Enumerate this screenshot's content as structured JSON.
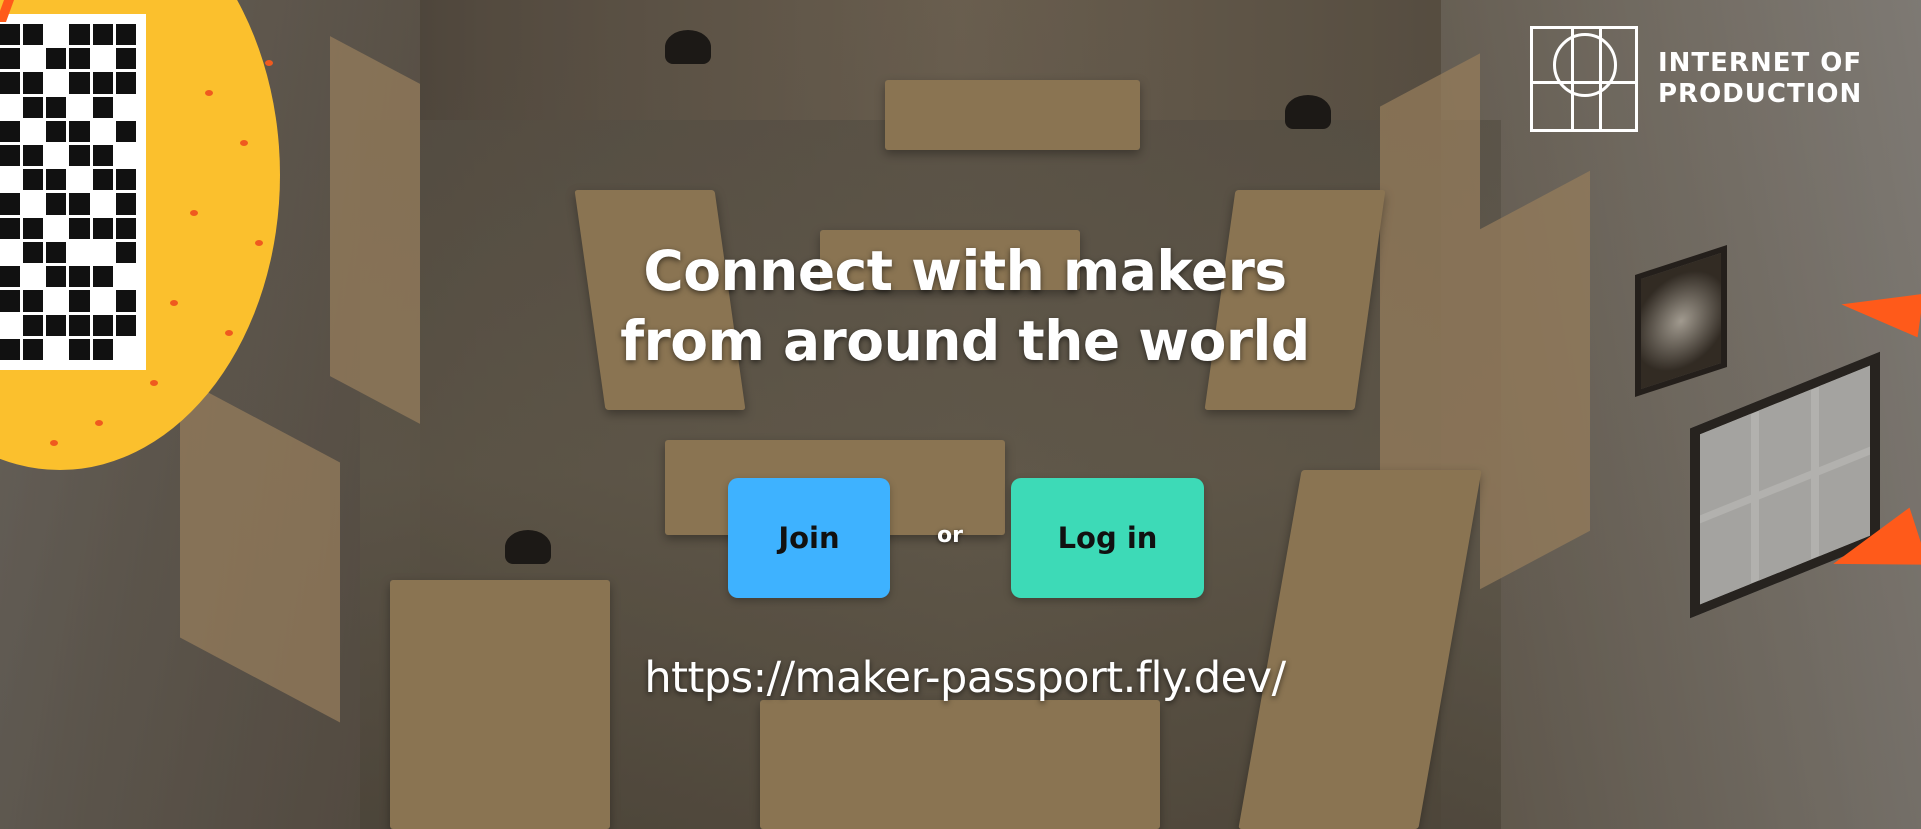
{
  "logo": {
    "line1": "INTERNET OF",
    "line2": "PRODUCTION"
  },
  "headline": {
    "line1": "Connect with makers",
    "line2": "from around the world"
  },
  "actions": {
    "join_label": "Join",
    "separator": "or",
    "login_label": "Log in"
  },
  "url": "https://maker-passport.fly.dev/",
  "colors": {
    "join_button": "#3eb2ff",
    "login_button": "#3ddab7",
    "yellow_accent": "#fbc02d",
    "orange_accent": "#ff5a1a"
  },
  "icons": {
    "qr_code": "qr-code-icon",
    "logo_mark": "internet-of-production-logo-icon"
  }
}
